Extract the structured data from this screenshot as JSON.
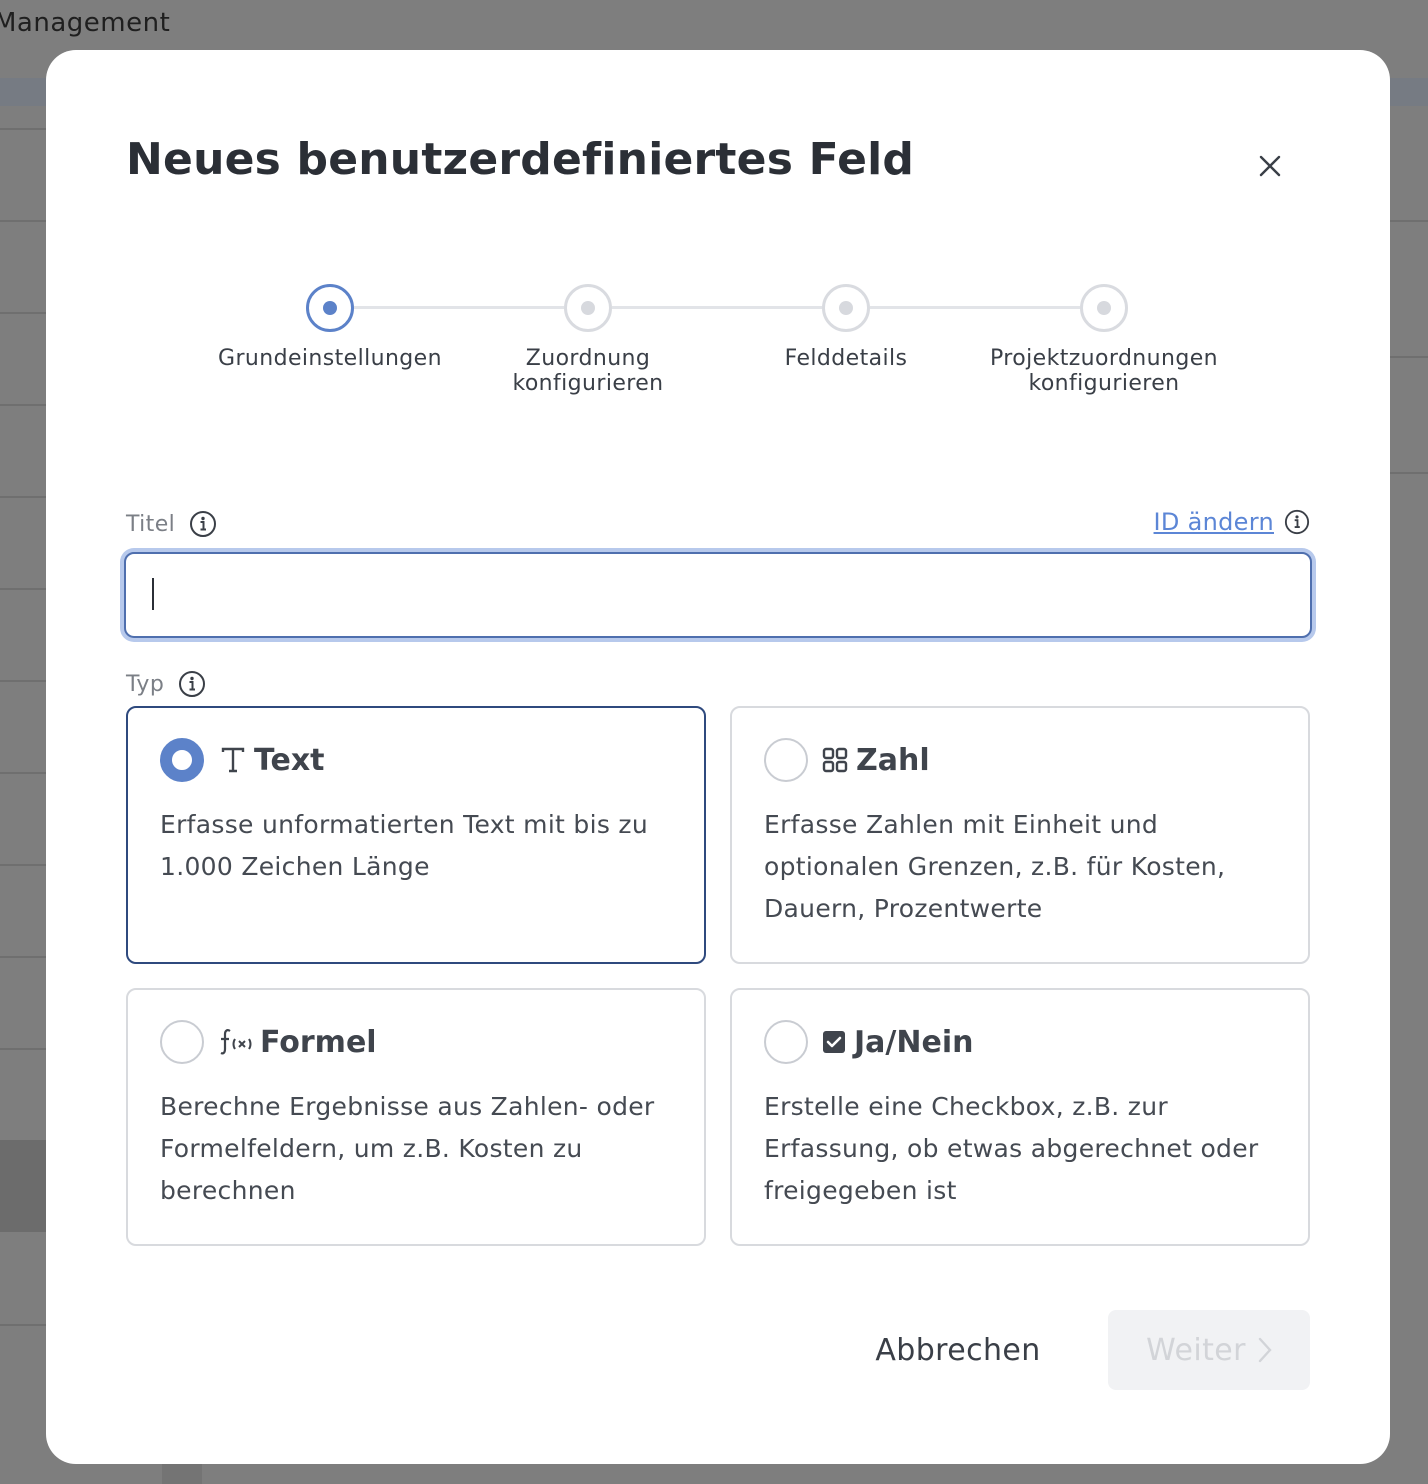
{
  "background": {
    "page_title": "Management"
  },
  "dialog": {
    "title": "Neues benutzerdefiniertes Feld",
    "close_icon": "close-icon"
  },
  "stepper": {
    "steps": [
      {
        "label": "Grundeinstellungen",
        "state": "active"
      },
      {
        "label": "Zuordnung\nkonfigurieren",
        "state": "inactive"
      },
      {
        "label": "Felddetails",
        "state": "inactive"
      },
      {
        "label": "Projektzuordnungen\nkonfigurieren",
        "state": "inactive"
      }
    ]
  },
  "form": {
    "title_label": "Titel",
    "id_link": "ID ändern",
    "title_value": "",
    "type_label": "Typ"
  },
  "types": [
    {
      "name": "Text",
      "icon": "text-type-icon",
      "selected": true,
      "description": "Erfasse unformatierten Text mit bis zu 1.000 Zeichen Länge"
    },
    {
      "name": "Zahl",
      "icon": "number-grid-icon",
      "selected": false,
      "description": "Erfasse Zahlen mit Einheit und optionalen Grenzen, z.B. für Kosten, Dauern, Prozentwerte"
    },
    {
      "name": "Formel",
      "icon": "formula-icon",
      "selected": false,
      "description": "Berechne Ergebnisse aus Zahlen- oder Formelfeldern, um z.B. Kosten zu berechnen"
    },
    {
      "name": "Ja/Nein",
      "icon": "checkbox-icon",
      "selected": false,
      "description": "Erstelle eine Checkbox, z.B. zur Erfassung, ob etwas abgerechnet oder freigegeben ist"
    }
  ],
  "footer": {
    "cancel_label": "Abbrechen",
    "next_label": "Weiter",
    "next_enabled": false
  },
  "colors": {
    "accent": "#5c82c9",
    "link": "#5c86d6",
    "selected_border": "#2f4a7e",
    "overlay": "#7e7e7e"
  }
}
